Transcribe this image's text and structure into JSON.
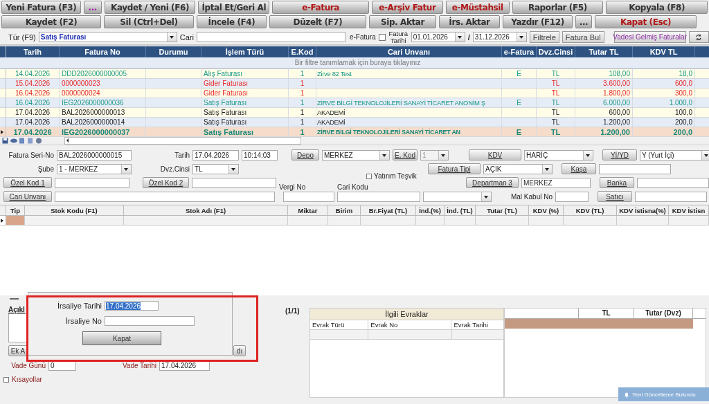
{
  "toolbar": {
    "buttons": [
      {
        "label": "Yeni Fatura (F3)",
        "color": "#333333"
      },
      {
        "label": "...",
        "color": "#9a1aa8"
      },
      {
        "label": "Kaydet / Yeni (F6)",
        "color": "#333333"
      },
      {
        "label": "İptal Et/Geri Al",
        "color": "#333333"
      },
      {
        "label": "e-Fatura",
        "color": "#b01818"
      },
      {
        "label": "e-Arşiv Fatur",
        "color": "#b01818"
      },
      {
        "label": "e-Müstahsil",
        "color": "#b01818"
      },
      {
        "label": "Raporlar (F5)",
        "color": "#333333"
      },
      {
        "label": "Kopyala (F8)",
        "color": "#333333"
      },
      {
        "label": "Kaydet (F2)",
        "color": "#333333"
      },
      {
        "label": "Sil (Ctrl+Del)",
        "color": "#333333"
      },
      {
        "label": "İncele (F4)",
        "color": "#333333"
      },
      {
        "label": "Düzelt (F7)",
        "color": "#333333"
      },
      {
        "label": "Sip. Aktar",
        "color": "#333333"
      },
      {
        "label": "İrs. Aktar",
        "color": "#333333"
      },
      {
        "label": "Yazdır (F12)",
        "color": "#333333"
      },
      {
        "label": "...",
        "color": "#333333"
      },
      {
        "label": "Kapat (Esc)",
        "color": "#b01818"
      }
    ]
  },
  "filter_bar": {
    "type_label": "Tür (F9)",
    "type_value": "Satış Faturası",
    "cari_label": "Cari",
    "efatura_label": "e-Fatura",
    "fatura_tarihi": {
      "label": "Fatura Tarihi",
      "checked": false
    },
    "date_from": "01.01.2026",
    "separator": "/",
    "date_to": "31.12.2026",
    "filter_button": "Filtrele",
    "find_button": "Fatura Bul",
    "due_button": "Vadesi Gelmiş Faturalar"
  },
  "invoice_table": {
    "columns": [
      "Tarih",
      "Fatura No",
      "Durumu",
      "İşlem Türü",
      "E.Kod",
      "Cari Unvanı",
      "e-Fatura",
      "Dvz.Cinsi",
      "Tutar TL",
      "KDV TL"
    ],
    "filter_hint": "Bir filtre tanımlamak için buraya tıklayınız",
    "rows": [
      {
        "cells": [
          "14.04.2026",
          "DDD2026000000005",
          "",
          "Alış Faturası",
          "1",
          "Zirve 82 Test",
          "E",
          "TL",
          "108,00",
          "18,0"
        ],
        "color": "#1a9a8a",
        "selected": false
      },
      {
        "cells": [
          "15.04.2026",
          "0000000023",
          "",
          "Gider Faturası",
          "1",
          "",
          "",
          "TL",
          "3.600,00",
          "600,0"
        ],
        "color": "#e82828",
        "selected": false
      },
      {
        "cells": [
          "16.04.2026",
          "0000000024",
          "",
          "Gider Faturası",
          "1",
          "",
          "",
          "TL",
          "1.800,00",
          "300,0"
        ],
        "color": "#e82828",
        "selected": false
      },
      {
        "cells": [
          "16.04.2026",
          "IEG2026000000036",
          "",
          "Satış Faturası",
          "1",
          "ZİRVE BİLGİ TEKNOLOJİLERİ SANAYİ TİCARET ANONİM Ş",
          "E",
          "TL",
          "6.000,00",
          "1.000,0"
        ],
        "color": "#1a9a8a",
        "selected": false
      },
      {
        "cells": [
          "17.04.2026",
          "BAL2026000000013",
          "",
          "Satış Faturası",
          "1",
          "AKADEMİ",
          "",
          "TL",
          "600,00",
          "100,0"
        ],
        "color": "#222222",
        "selected": false
      },
      {
        "cells": [
          "17.04.2026",
          "BAL2026000000014",
          "",
          "Satış Faturası",
          "1",
          "AKADEMİ",
          "",
          "TL",
          "1.200,00",
          "200,0"
        ],
        "color": "#222222",
        "selected": false
      },
      {
        "cells": [
          "17.04.2026",
          "IEG2026000000037",
          "",
          "Satış Faturası",
          "1",
          "ZİRVE BİLGİ TEKNOLOJİLERİ SANAYİ TİCARET AN",
          "E",
          "TL",
          "1.200,00",
          "200,0"
        ],
        "color": "#1a8a7a",
        "selected": true
      }
    ]
  },
  "form": {
    "seri_no": {
      "label": "Fatura Seri-No",
      "value": "BAL2026000000015"
    },
    "tarih": {
      "label": "Tarih",
      "value": "17.04.2026",
      "time": "10:14:03"
    },
    "depo": {
      "button": "Depo",
      "value": "MERKEZ"
    },
    "e_kod": {
      "button": "E. Kod",
      "value": "1"
    },
    "kdv": {
      "button": "KDV",
      "value": "HARİÇ"
    },
    "yi_yd": {
      "button": "Yİ/YD",
      "value": "Y (Yurt İçi)"
    },
    "sube": {
      "label": "Şube",
      "value": "1 - MERKEZ"
    },
    "dvz": {
      "label": "Dvz.Cinsi",
      "value": "TL"
    },
    "yatirim_tesvik": {
      "label": "Yatırım Teşvik",
      "checked": false
    },
    "fatura_tipi": {
      "button": "Fatura Tipi",
      "value": "AÇIK"
    },
    "kasa": {
      "button": "Kaşa"
    },
    "ozel_kod_1": {
      "button": "Özel Kod 1"
    },
    "ozel_kod_2": {
      "button": "Özel Kod 2"
    },
    "vergi_no": {
      "label": "Vergi No"
    },
    "cari_kodu": {
      "label": "Cari Kodu"
    },
    "departman": {
      "button": "Departman 3",
      "value": "MERKEZ"
    },
    "banka": {
      "button": "Banka"
    },
    "cari_unvani": {
      "button": "Cari Unvanı"
    },
    "mal_kabul": {
      "label": "Mal Kabul No"
    },
    "satici": {
      "button": "Satıcı"
    }
  },
  "items_table": {
    "columns": [
      "Tip",
      "Stok Kodu (F1)",
      "Stok Adı (F1)",
      "Miktar",
      "Birim",
      "Br.Fiyat (TL)",
      "İnd.(%)",
      "İnd. (TL)",
      "Tutar (TL)",
      "KDV (%)",
      "KDV (TL)",
      "KDV İstisna(%)",
      "KDV İstisn"
    ]
  },
  "bottom": {
    "aciklama_label": "Açıkl",
    "ek_button": "Ek A",
    "other_button": "dı",
    "vade_gunu": {
      "label": "Vade Günü",
      "value": "0"
    },
    "vade_tarihi": {
      "label": "Vade Tarihi",
      "value": "17.04.2026"
    },
    "kisayollar": {
      "label": "Kısayollar",
      "checked": false
    },
    "page_count": "(1/1)"
  },
  "irsaliye_popup": {
    "date_label": "İrsaliye Tarihi",
    "date_value": "17.04.2026",
    "no_label": "İrsaliye No",
    "close_button": "Kapat"
  },
  "related_docs": {
    "title": "İlgili Evraklar",
    "columns": [
      "Evrak Türü",
      "Evrak No",
      "Evrak Tarihi"
    ]
  },
  "totals": {
    "columns": [
      "TL",
      "Tutar (Dvz)"
    ]
  },
  "notification": {
    "text": "Yeni Güncelleme Bulundu"
  }
}
